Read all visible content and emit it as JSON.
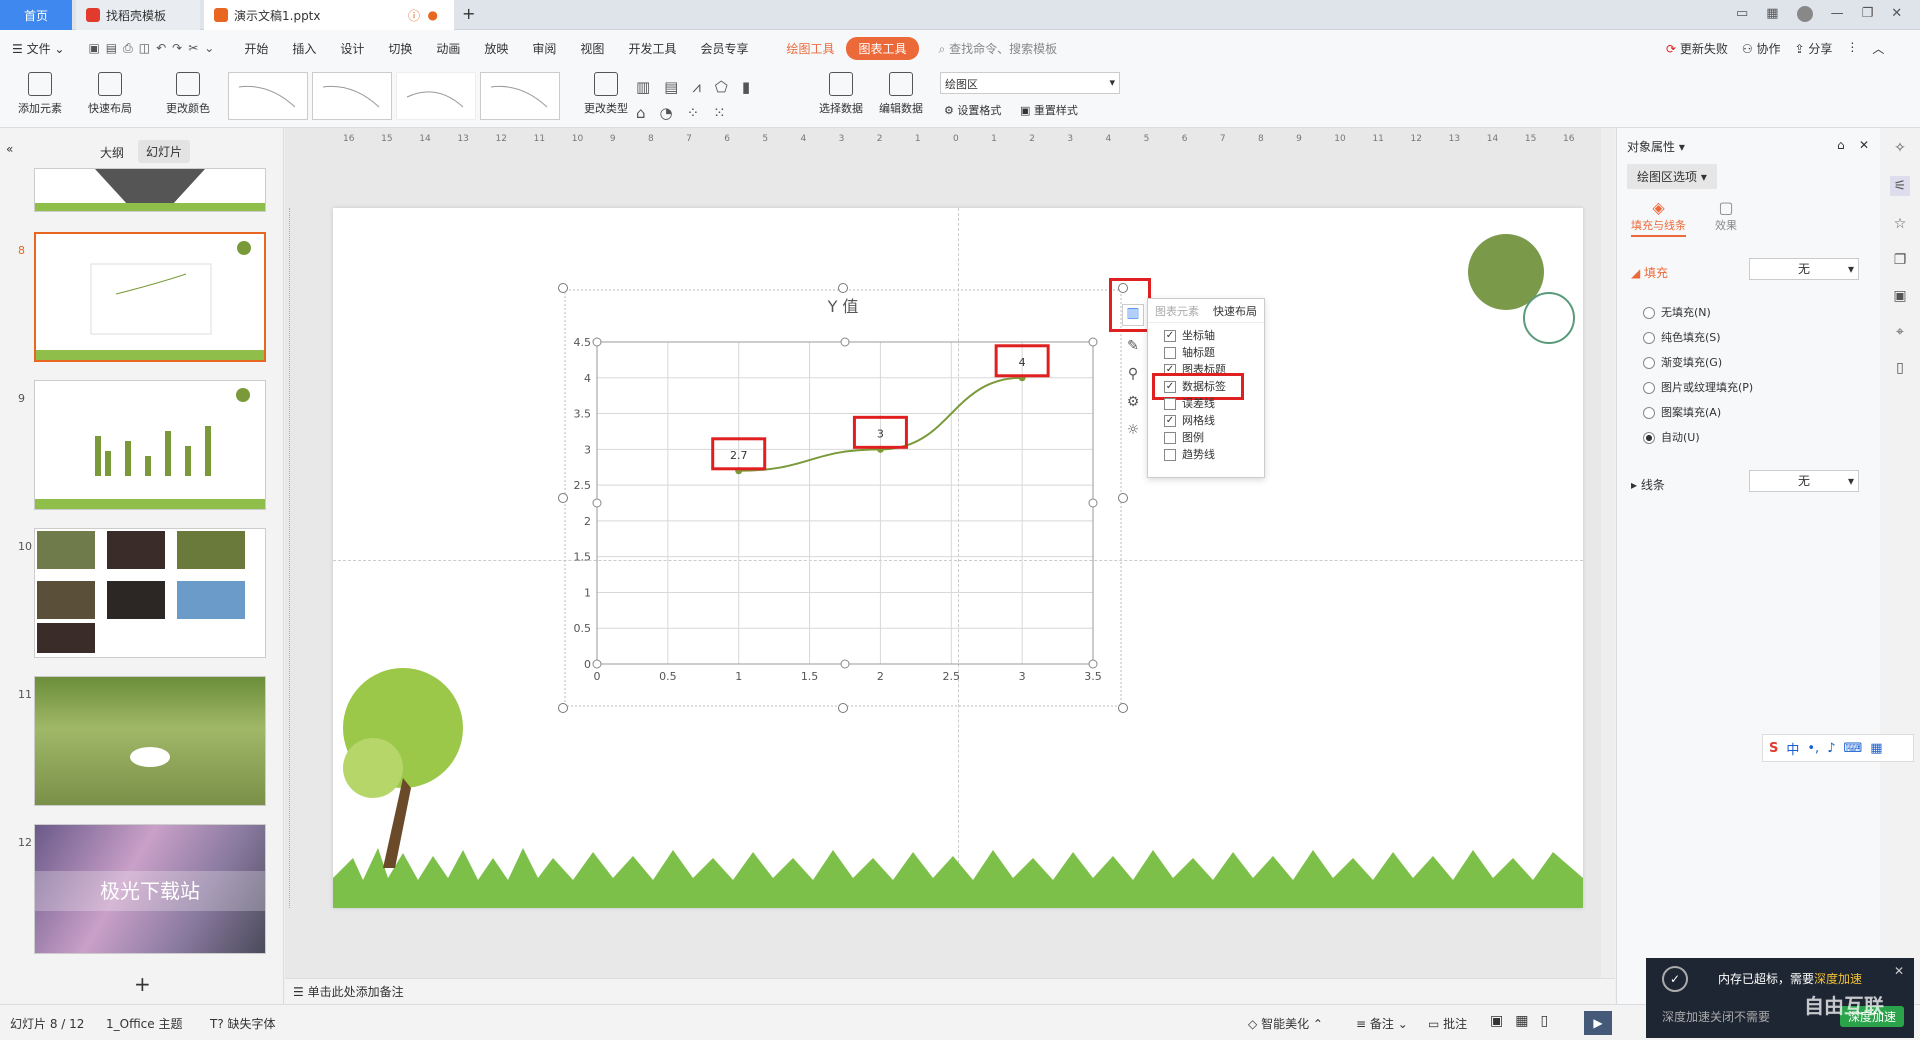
{
  "titlebar": {
    "home_tab": "首页",
    "docer_tab": "找稻壳模板",
    "doc_tab": "演示文稿1.pptx"
  },
  "menu": {
    "file": "文件",
    "items": [
      "开始",
      "插入",
      "设计",
      "切换",
      "动画",
      "放映",
      "审阅",
      "视图",
      "开发工具",
      "会员专享"
    ],
    "drawing_tools": "绘图工具",
    "chart_tools": "图表工具",
    "search": "查找命令、搜索模板",
    "update_failed": "更新失败",
    "collab": "协作",
    "share": "分享"
  },
  "ribbon": {
    "add_element": "添加元素",
    "quick_layout": "快速布局",
    "change_color": "更改颜色",
    "change_type": "更改类型",
    "select_data": "选择数据",
    "edit_data": "编辑数据",
    "area_select": "绘图区",
    "set_format": "设置格式",
    "reset_style": "重置样式"
  },
  "leftpane": {
    "outline_tab": "大纲",
    "slides_tab": "幻灯片",
    "slides": [
      {
        "no": ""
      },
      {
        "no": "8"
      },
      {
        "no": "9"
      },
      {
        "no": "10"
      },
      {
        "no": "11"
      },
      {
        "no": "12"
      }
    ],
    "slide12_text": "极光下载站",
    "add": "+"
  },
  "chart_data": {
    "type": "line",
    "title": "Y 值",
    "x": [
      1,
      2,
      3
    ],
    "values": [
      2.7,
      3,
      4
    ],
    "data_labels": [
      "2.7",
      "3",
      "4"
    ],
    "xlim": [
      0,
      3.5
    ],
    "ylim": [
      0,
      4.5
    ],
    "x_ticks": [
      "0",
      "0.5",
      "1",
      "1.5",
      "2",
      "2.5",
      "3",
      "3.5"
    ],
    "y_ticks": [
      "0",
      "0.5",
      "1",
      "1.5",
      "2",
      "2.5",
      "3",
      "3.5",
      "4",
      "4.5"
    ],
    "grid": true,
    "color": "#7a9a3a"
  },
  "chart_popup": {
    "tab_elements": "图表元素",
    "tab_layout": "快速布局",
    "items": [
      {
        "label": "坐标轴",
        "checked": true
      },
      {
        "label": "轴标题",
        "checked": false
      },
      {
        "label": "图表标题",
        "checked": true
      },
      {
        "label": "数据标签",
        "checked": true
      },
      {
        "label": "误差线",
        "checked": false
      },
      {
        "label": "网格线",
        "checked": true
      },
      {
        "label": "图例",
        "checked": false
      },
      {
        "label": "趋势线",
        "checked": false
      }
    ]
  },
  "ruler": {
    "labels": [
      "16",
      "15",
      "14",
      "13",
      "12",
      "11",
      "10",
      "9",
      "8",
      "7",
      "6",
      "5",
      "4",
      "3",
      "2",
      "1",
      "0",
      "1",
      "2",
      "3",
      "4",
      "5",
      "6",
      "7",
      "8",
      "9",
      "10",
      "11",
      "12",
      "13",
      "14",
      "15",
      "16"
    ]
  },
  "rightpane": {
    "title": "对象属性",
    "area_options": "绘图区选项",
    "tab_fill": "填充与线条",
    "tab_effect": "效果",
    "fill_label": "填充",
    "fill_value": "无",
    "options": [
      "无填充(N)",
      "纯色填充(S)",
      "渐变填充(G)",
      "图片或纹理填充(P)",
      "图案填充(A)",
      "自动(U)"
    ],
    "line_label": "线条",
    "line_value": "无"
  },
  "notes": "单击此处添加备注",
  "status": {
    "slide_count": "幻灯片 8 / 12",
    "theme": "1_Office 主题",
    "missing_font": "缺失字体",
    "beautify": "智能美化",
    "notes": "备注",
    "comment": "批注"
  },
  "notification": {
    "line1_a": "内存已超标，需要",
    "line1_b": "深度加速",
    "line2": "深度加速关闭不需要",
    "button": "深度加速"
  },
  "ime": {
    "label": "中"
  },
  "watermark": "自由互联"
}
